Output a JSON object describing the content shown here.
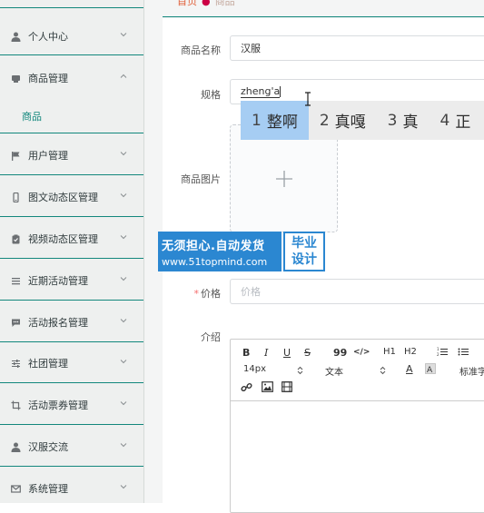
{
  "sidebar": {
    "items": [
      {
        "label": "个人中心",
        "icon": "user-icon",
        "expanded": false
      },
      {
        "label": "商品管理",
        "icon": "goods-icon",
        "expanded": true
      },
      {
        "label": "用户管理",
        "icon": "flag-icon",
        "expanded": false
      },
      {
        "label": "图文动态区管理",
        "icon": "phone-icon",
        "expanded": false
      },
      {
        "label": "视频动态区管理",
        "icon": "clipboard-icon",
        "expanded": false
      },
      {
        "label": "近期活动管理",
        "icon": "list-icon",
        "expanded": false
      },
      {
        "label": "活动报名管理",
        "icon": "chat-icon",
        "expanded": false
      },
      {
        "label": "社团管理",
        "icon": "sliders-icon",
        "expanded": false
      },
      {
        "label": "活动票券管理",
        "icon": "crop-icon",
        "expanded": false
      },
      {
        "label": "汉服交流",
        "icon": "user-icon",
        "expanded": false
      },
      {
        "label": "系统管理",
        "icon": "mail-icon",
        "expanded": false
      }
    ],
    "sub_item": "商品"
  },
  "breadcrumb": {
    "home": "首页",
    "current": "商品"
  },
  "form": {
    "name_label": "商品名称",
    "name_value": "汉服",
    "spec_label": "规格",
    "spec_value": "zheng'a",
    "image_label": "商品图片",
    "price_label": "价格",
    "price_placeholder": "价格",
    "intro_label": "介绍"
  },
  "ime": {
    "candidates": [
      {
        "num": "1",
        "text": "整啊"
      },
      {
        "num": "2",
        "text": "真嘎"
      },
      {
        "num": "3",
        "text": "真"
      },
      {
        "num": "4",
        "text": "正"
      }
    ]
  },
  "watermark": {
    "line1": "无须担心.自动发货",
    "line2": "www.51topmind.com",
    "badge1": "毕业",
    "badge2": "设计"
  },
  "editor": {
    "bold": "B",
    "italic": "I",
    "underline": "U",
    "strike": "S",
    "quote": "99",
    "code": "</>",
    "h1": "H1",
    "h2": "H2",
    "font_size": "14px",
    "font_type": "文本",
    "font_color": "A",
    "standard": "标准字"
  },
  "colors": {
    "accent": "#12877c",
    "breadcrumb": "#e0603a",
    "ime_highlight": "#a6cdf3",
    "watermark": "#2b87d1"
  }
}
